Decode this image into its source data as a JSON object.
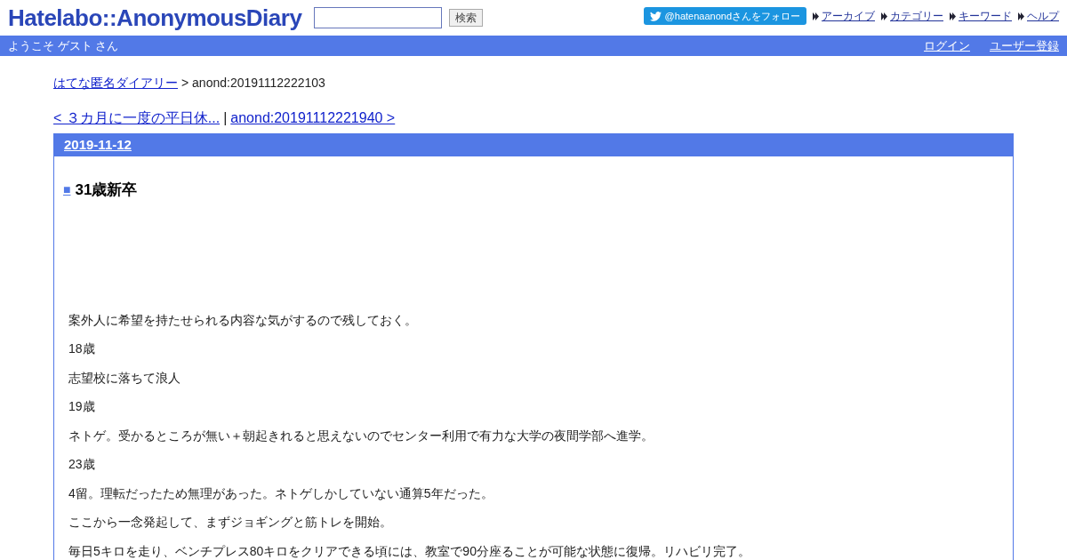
{
  "header": {
    "logo": "Hatelabo::AnonymousDiary",
    "search": {
      "button": "検索"
    },
    "follow_button": "@hatenaanondさんをフォロー",
    "links": [
      "アーカイブ",
      "カテゴリー",
      "キーワード",
      "ヘルプ"
    ]
  },
  "user_bar": {
    "welcome": "ようこそ ゲスト さん",
    "links": [
      "ログイン",
      "ユーザー登録"
    ]
  },
  "breadcrumb": {
    "link": "はてな匿名ダイアリー",
    "current": "> anond:20191112222103"
  },
  "pager": {
    "prev": "< ３カ月に一度の平日休...",
    "separator": "|",
    "next": "anond:20191112221940 >"
  },
  "day": {
    "date": "2019-11-12",
    "entry": {
      "mark": "■",
      "title": "31歳新卒",
      "paragraphs": [
        "案外人に希望を持たせられる内容な気がするので残しておく。",
        "18歳",
        "志望校に落ちて浪人",
        "19歳",
        "ネトゲ。受かるところが無い＋朝起きれると思えないのでセンター利用で有力な大学の夜間学部へ進学。",
        "23歳",
        "4留。理転だったため無理があった。ネトゲしかしていない通算5年だった。",
        "ここから一念発起して、まずジョギングと筋トレを開始。",
        "毎日5キロを走り、ベンチプレス80キロをクリアできる頃には、教室で90分座ることが可能な状態に復帰。リハビリ完了。"
      ]
    }
  }
}
